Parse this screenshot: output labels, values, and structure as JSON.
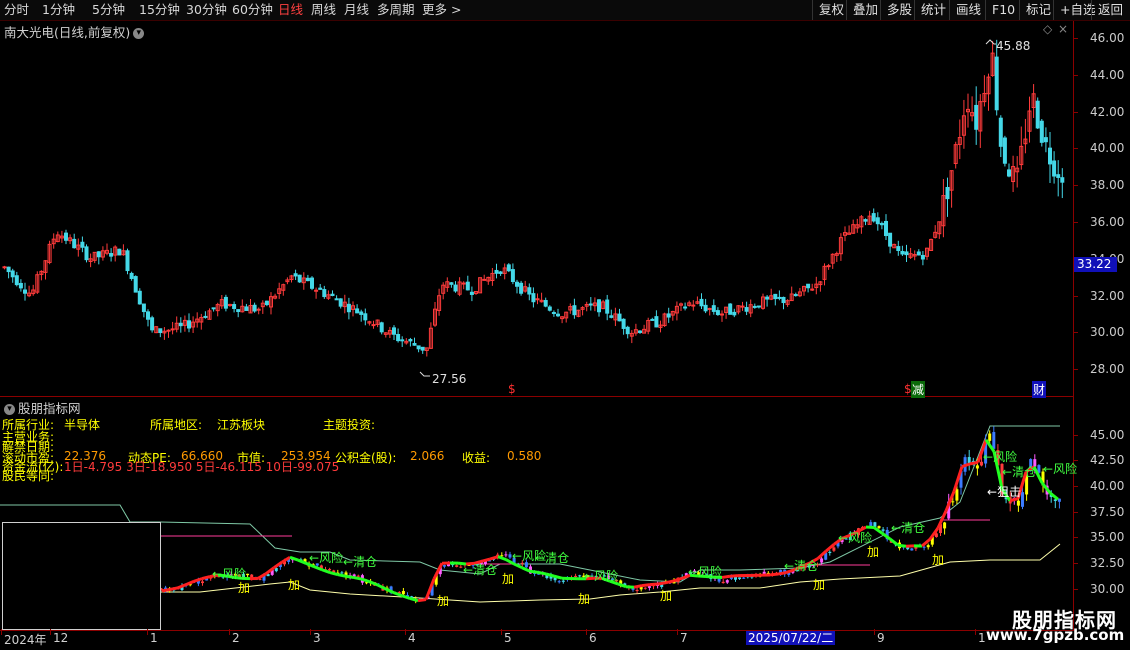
{
  "toolbar": {
    "periods": [
      "分时",
      "1分钟",
      "5分钟",
      "15分钟",
      "30分钟",
      "60分钟",
      "日线",
      "周线",
      "月线",
      "多周期",
      "更多 >"
    ],
    "active_period": "日线",
    "actions": [
      "复权",
      "叠加",
      "多股",
      "统计",
      "画线",
      "F10",
      "标记",
      "+自选",
      "返回"
    ]
  },
  "main_panel": {
    "title": "南大光电(日线,前复权)",
    "high_label": "45.88",
    "low_label": "27.56",
    "current_price": "33.22",
    "markers": [
      "$",
      "$",
      "减",
      "财"
    ],
    "y_ticks": [
      "46.00",
      "44.00",
      "42.00",
      "40.00",
      "38.00",
      "36.00",
      "34.00",
      "32.00",
      "30.00",
      "28.00"
    ]
  },
  "indicator_panel": {
    "title": "股朋指标网",
    "info": {
      "industry_label": "所属行业:",
      "industry_value": "半导体",
      "region_label": "所属地区:",
      "region_value": "江苏板块",
      "theme_label": "主题投资:",
      "business_label": "主营业务:",
      "unlock_label": "解禁日期:",
      "pe_label": "滚动市盈:",
      "pe_value": "22.376",
      "dyn_pe_label": "动态PE:",
      "dyn_pe_value": "66.660",
      "mcap_label": "市值:",
      "mcap_value": "253.954",
      "reserve_label": "公积金(股):",
      "reserve_value": "2.066",
      "income_label": "收益:",
      "income_value": "0.580",
      "flow_label": "资金流(亿):",
      "flow_value": "1日-4.795  3日-18.950  5日-46.115  10日-99.075",
      "holder_label": "股民等同:"
    },
    "signals": {
      "risk": "风险",
      "clear": "清仓",
      "add": "加",
      "snipe": "狙击"
    },
    "y_ticks": [
      "45.00",
      "42.50",
      "40.00",
      "37.50",
      "35.00",
      "32.50",
      "30.00"
    ]
  },
  "x_axis": {
    "labels": [
      "2024年",
      "12",
      "1",
      "2",
      "3",
      "4",
      "5",
      "6",
      "7",
      "2025/07/22/二",
      "9",
      "1"
    ]
  },
  "watermark": {
    "title": "股朋指标网",
    "url": "www.7gpzb.com"
  },
  "colors": {
    "up": "#ff3b3b",
    "down": "#44d8e8",
    "ma_line": "#ffffff",
    "risk": "#40ff40",
    "clear": "#40ff40",
    "add": "#ffff00",
    "axis": "#8b0000"
  }
}
